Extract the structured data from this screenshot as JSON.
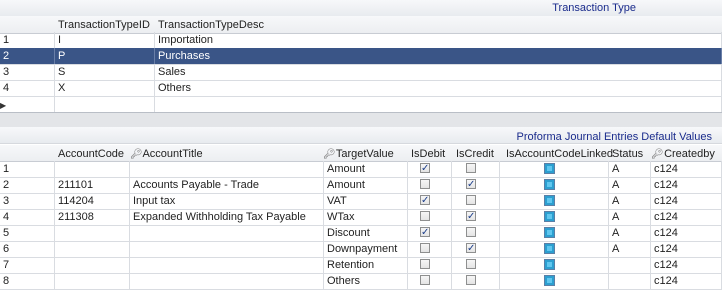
{
  "top": {
    "title": "Transaction Type",
    "columns": [
      "TransactionTypeID",
      "TransactionTypeDesc"
    ],
    "rows": [
      {
        "num": "1",
        "id": "I",
        "desc": "Importation"
      },
      {
        "num": "2",
        "id": "P",
        "desc": "Purchases"
      },
      {
        "num": "3",
        "id": "S",
        "desc": "Sales"
      },
      {
        "num": "4",
        "id": "X",
        "desc": "Others"
      }
    ],
    "new_row_marker": "▶"
  },
  "bottom": {
    "title": "Proforma Journal Entries Default Values",
    "columns": {
      "account_code": "AccountCode",
      "account_title": "AccountTitle",
      "target_value": "TargetValue",
      "is_debit": "IsDebit",
      "is_credit": "IsCredit",
      "is_linked": "IsAccountCodeLinked",
      "status": "Status",
      "created_by": "Createdby"
    },
    "rows": [
      {
        "num": "1",
        "code": "",
        "title": "",
        "target": "Amount",
        "debit": true,
        "credit": false,
        "status": "A",
        "created_by": "c124"
      },
      {
        "num": "2",
        "code": "211101",
        "title": "Accounts Payable - Trade",
        "target": "Amount",
        "debit": false,
        "credit": true,
        "status": "A",
        "created_by": "c124"
      },
      {
        "num": "3",
        "code": "114204",
        "title": "Input tax",
        "target": "VAT",
        "debit": true,
        "credit": false,
        "status": "A",
        "created_by": "c124"
      },
      {
        "num": "4",
        "code": "211308",
        "title": "Expanded Withholding Tax Payable",
        "target": "WTax",
        "debit": false,
        "credit": true,
        "status": "A",
        "created_by": "c124"
      },
      {
        "num": "5",
        "code": "",
        "title": "",
        "target": "Discount",
        "debit": true,
        "credit": false,
        "status": "A",
        "created_by": "c124"
      },
      {
        "num": "6",
        "code": "",
        "title": "",
        "target": "Downpayment",
        "debit": false,
        "credit": true,
        "status": "A",
        "created_by": "c124"
      },
      {
        "num": "7",
        "code": "",
        "title": "",
        "target": "Retention",
        "debit": false,
        "credit": false,
        "status": "",
        "created_by": "c124"
      },
      {
        "num": "8",
        "code": "",
        "title": "",
        "target": "Others",
        "debit": false,
        "credit": false,
        "status": "",
        "created_by": "c124"
      }
    ]
  }
}
